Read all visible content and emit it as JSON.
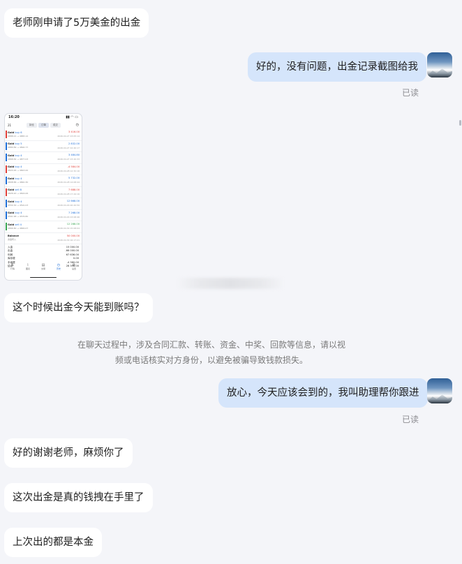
{
  "messages": {
    "m1": "老师刚申请了5万美金的出金",
    "m2": "好的，没有问题，出金记录截图给我",
    "m3": "这个时候出金今天能到账吗？",
    "m4": "放心，今天应该会到的，我叫助理帮你跟进",
    "m5": "好的谢谢老师，麻烦你了",
    "m6": "这次出金是真的钱拽在手里了",
    "m7": "上次出的都是本金"
  },
  "read_label": "已读",
  "notice": {
    "line1": "在聊天过程中，涉及合同汇款、转账、资金、中奖、回款等信息，请以视",
    "line2": "频或电话核实对方身份，以避免被骗导致钱款损失。"
  },
  "phone": {
    "time": "16:20",
    "signal": "▮▮ ◠ ▭",
    "header_left": "21",
    "tabs": [
      "持仓",
      "订单",
      "成交"
    ],
    "rows": [
      {
        "symbol": "Gold",
        "side": "buy 6",
        "prices": "4888.21 → 4883.12",
        "value": "3 416.00",
        "time": "2026.04.27 23:05:14",
        "color": "#e0403a"
      },
      {
        "symbol": "Gold",
        "side": "buy 5",
        "prices": "4880.89 → 4892.77",
        "value": "2 832.00",
        "time": "2026.04.27 22:40:17",
        "color": "#1e6fd9"
      },
      {
        "symbol": "Gold",
        "side": "buy 4",
        "prices": "4868.82 → 4877.03",
        "value": "3 484.80",
        "time": "2026.04.27 23:20:33",
        "color": "#1e6fd9"
      },
      {
        "symbol": "Gold",
        "side": "buy 4",
        "prices": "4824.46 → 4843.00",
        "value": "-4 584.00",
        "time": "2026.04.28 12:32:16",
        "color": "#e0403a"
      },
      {
        "symbol": "Gold",
        "side": "buy 4",
        "prices": "4808.86 → 4840.30",
        "value": "5 732.00",
        "time": "2026.04.28 14:08:44",
        "color": "#1e6fd9"
      },
      {
        "symbol": "Gold",
        "side": "sell 8",
        "prices": "4826.20 → 4816.06",
        "value": "7 688.00",
        "time": "2026.04.28 17:44:16",
        "color": "#e0403a"
      },
      {
        "symbol": "Gold",
        "side": "buy 4",
        "prices": "4550.30 → 4591.03",
        "value": "12 668.00",
        "time": "2026.04.29 20:20:50",
        "color": "#1e6fd9"
      },
      {
        "symbol": "Gold",
        "side": "buy 4",
        "prices": "4561.68 → 4576.80",
        "value": "7 268.00",
        "time": "2026.04.29 23:08:46",
        "color": "#1e6fd9"
      },
      {
        "symbol": "Gold",
        "side": "sell 4",
        "prices": "4866.80 → 4846.07",
        "value": "12 288.00",
        "time": "2026.04.30 15:08:04",
        "color": "#3aa655"
      }
    ],
    "balance": {
      "label": "Balance",
      "sub": "资金转入",
      "value": "50 000.00",
      "time": "2026.04.30 16:17:21"
    },
    "summary": [
      {
        "label": "入金",
        "value": "15 000.00"
      },
      {
        "label": "出金",
        "value": "-66 000.00"
      },
      {
        "label": "利润",
        "value": "67 636.00"
      },
      {
        "label": "库存费",
        "value": "0.00"
      },
      {
        "label": "手续费",
        "value": "-4 380.00"
      },
      {
        "label": "结余",
        "value": "28 396.00"
      }
    ],
    "nav": [
      "行情",
      "图表",
      "交易",
      "历史",
      "设置"
    ]
  },
  "colors": {
    "background": "#f4f5f9",
    "incoming_bubble": "#ffffff",
    "outgoing_bubble": "#d5e5fb",
    "notice_text": "#7a7a7a"
  }
}
